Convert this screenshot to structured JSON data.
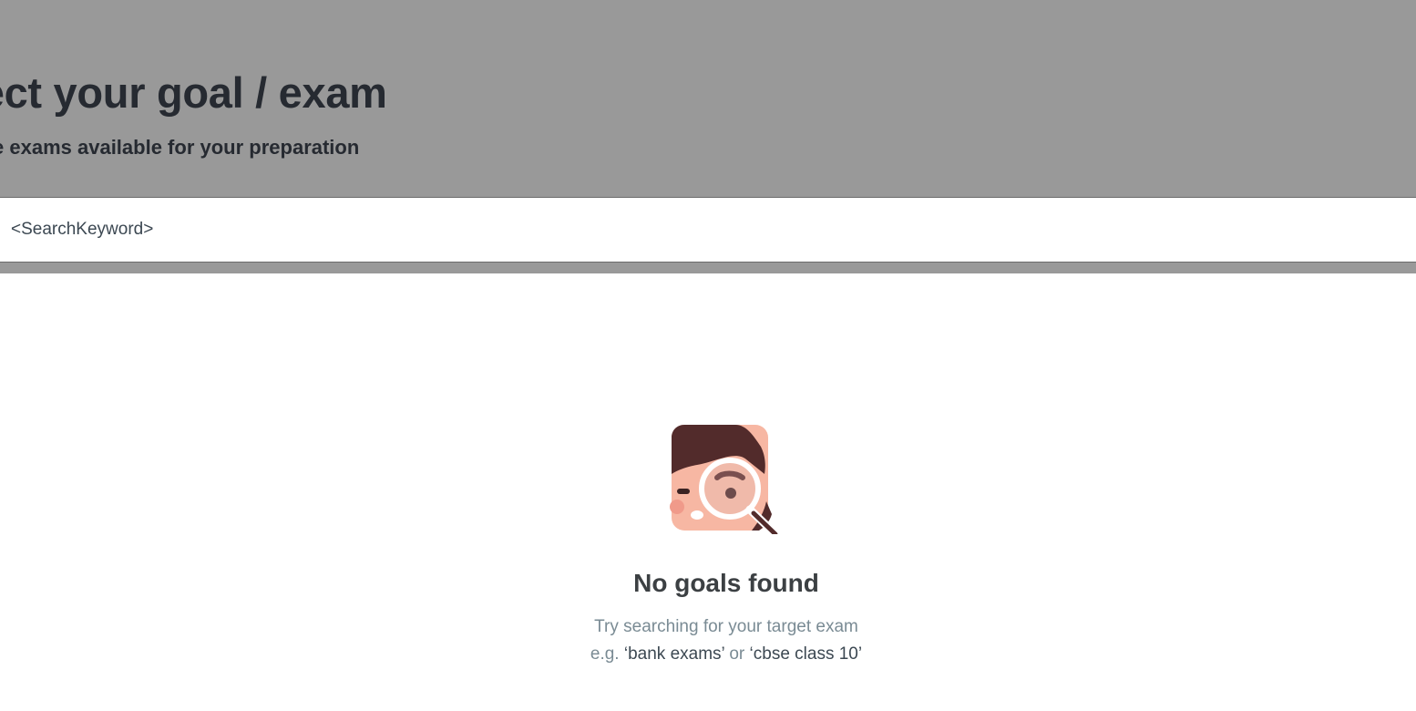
{
  "header": {
    "title": "lect your goal / exam",
    "subtitle": "exams available for your preparation",
    "subtitle_prefix": "e"
  },
  "search": {
    "value": "<SearchKeyword>",
    "placeholder": ""
  },
  "empty_state": {
    "illustration": "search-girl-magnifier-illustration",
    "title": "No goals found",
    "hint_line1": "Try searching for your target exam",
    "hint_prefix": "e.g.",
    "example1": "‘bank exams’",
    "connector": "or",
    "example2": "‘cbse class 10’"
  },
  "colors": {
    "overlay": "#999999",
    "heading": "#262a31",
    "muted": "#7a8b94",
    "illustration_hair": "#522b2b",
    "illustration_skin": "#f7b7a3"
  }
}
